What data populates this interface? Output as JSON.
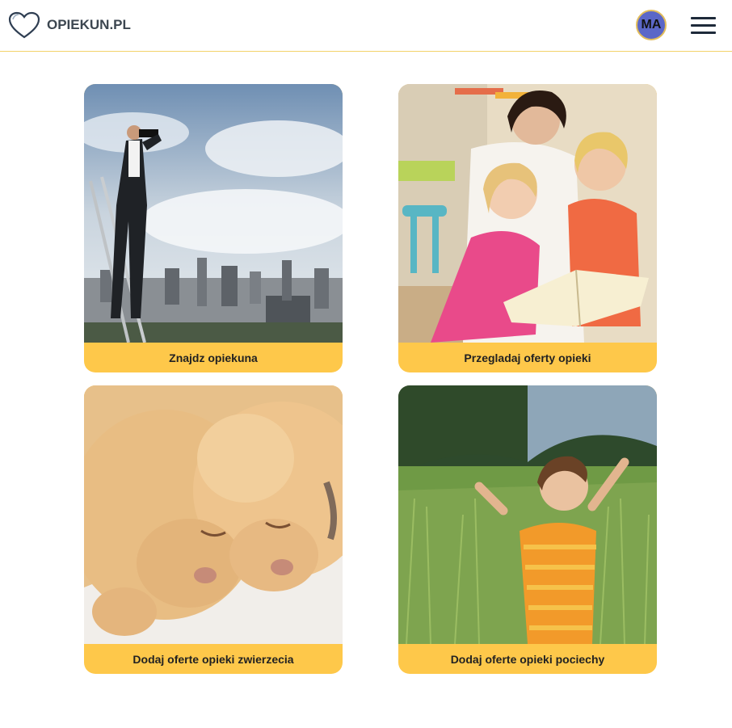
{
  "header": {
    "logo_text": "OPIEKUN.PL",
    "avatar_initials": "MA",
    "menu_icon": "hamburger-icon"
  },
  "colors": {
    "accent": "#fec84a",
    "avatar_bg": "#5b67c8",
    "header_border": "#f3d36a"
  },
  "cards": [
    {
      "label": "Znajdz opiekuna",
      "image": "man-with-binoculars-on-ladder-city"
    },
    {
      "label": "Przegladaj oferty opieki",
      "image": "caregiver-reading-book-to-children"
    },
    {
      "label": "Dodaj oferte opieki zwierzecia",
      "image": "sleeping-puppies"
    },
    {
      "label": "Dodaj oferte opieki pociechy",
      "image": "boy-in-grass-field"
    }
  ]
}
